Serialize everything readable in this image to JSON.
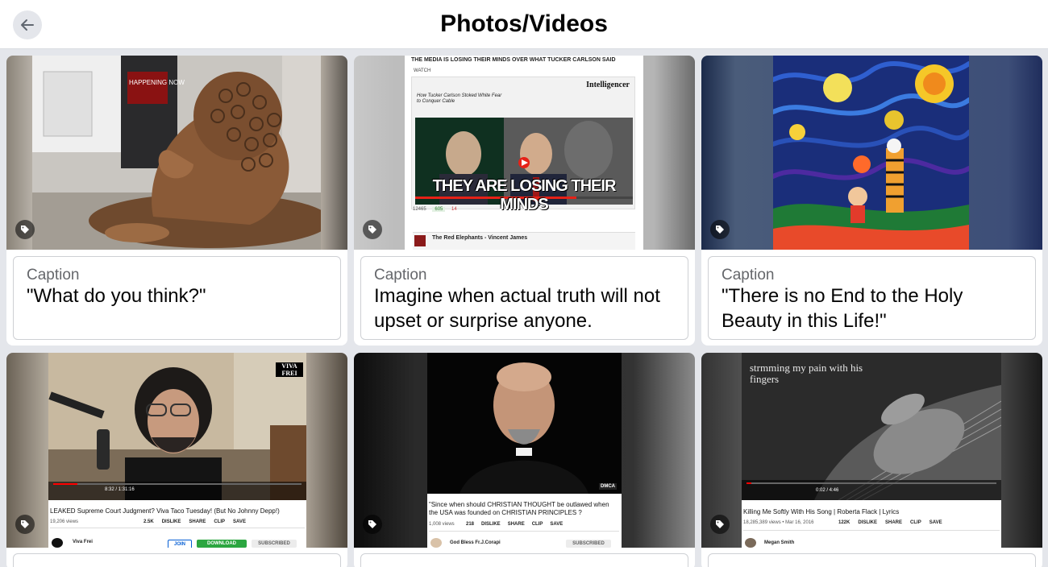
{
  "header": {
    "title": "Photos/Videos",
    "back_label": "Back"
  },
  "caption_label": "Caption",
  "cards": [
    {
      "caption": "\"What do you think?\"",
      "subject": "lion-statue",
      "sign_text": "HAPPENING NOW"
    },
    {
      "caption": "Imagine when actual truth will not upset or surprise anyone.",
      "subject": "video-screenshot",
      "headline": "THE MEDIA IS LOSING THEIR MINDS OVER WHAT TUCKER CARLSON SAID",
      "watch": "WATCH",
      "publication": "Intelligencer",
      "article_headline": "How Tucker Carlson Stoked White Fear to Conquer Cable",
      "overlay_text": "THEY ARE LOSING THEIR MINDS",
      "views": "12465",
      "likes": "605",
      "dislikes": "14",
      "channel_line": "The Red Elephants - Vincent James"
    },
    {
      "caption": "\"There is no End to the Holy Beauty in this Life!\"",
      "subject": "starry-night-art"
    },
    {
      "caption": "",
      "subject": "youtube-viva-frei",
      "logo_text_1": "VIVA",
      "logo_text_2": "FREI",
      "time": "8:32 / 1:31:16",
      "title": "LEAKED Supreme Court Judgment? Viva Taco Tuesday! (But No Johnny Depp!)",
      "views": "19,206 views",
      "likes": "2.5K",
      "dislike": "DISLIKE",
      "share": "SHARE",
      "clip": "CLIP",
      "save": "SAVE",
      "channel": "Viva Frei",
      "join": "JOIN",
      "download": "DOWNLOAD",
      "subscribed": "SUBSCRIBED"
    },
    {
      "caption": "",
      "subject": "youtube-priest",
      "badge": "DMCA",
      "title": "\"Since when should CHRISTIAN THOUGHT be outlawed when the USA was founded on CHRISTIAN PRINCIPLES ?",
      "views": "1,008 views",
      "likes": "218",
      "dislike": "DISLIKE",
      "share": "SHARE",
      "clip": "CLIP",
      "save": "SAVE",
      "channel": "God Bless Fr.J.Corapi",
      "subscribed": "SUBSCRIBED"
    },
    {
      "caption": "",
      "subject": "youtube-guitar",
      "overlay_text": "strmming my pain with his fingers",
      "time": "0:02 / 4:46",
      "title": "Killing Me Softly With His Song | Roberta Flack | Lyrics",
      "views": "18,285,389 views • Mar 16, 2016",
      "likes": "122K",
      "dislike": "DISLIKE",
      "share": "SHARE",
      "clip": "CLIP",
      "save": "SAVE",
      "channel": "Megan Smith"
    }
  ],
  "colors": {
    "tag_bg": "#00000088",
    "accent": "#1877f2",
    "yt_red": "#ff0000",
    "yt_green": "#2ba640"
  }
}
